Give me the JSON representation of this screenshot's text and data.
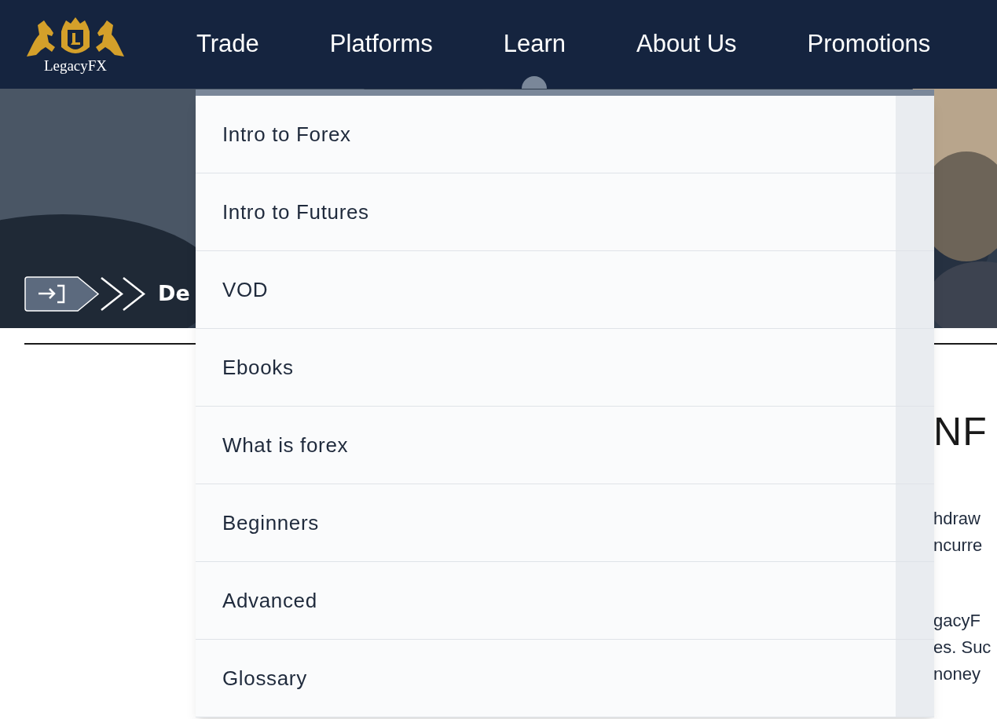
{
  "logo": {
    "text": "LegacyFX"
  },
  "nav": [
    {
      "label": "Trade",
      "selected": false
    },
    {
      "label": "Platforms",
      "selected": false
    },
    {
      "label": "Learn",
      "selected": true
    },
    {
      "label": "About Us",
      "selected": false
    },
    {
      "label": "Promotions",
      "selected": false
    }
  ],
  "breadcrumb": {
    "text": "De"
  },
  "learn_menu": [
    "Intro to Forex",
    "Intro to Futures",
    "VOD",
    "Ebooks",
    "What is forex",
    "Beginners",
    "Advanced",
    "Glossary"
  ],
  "content": {
    "heading": "NF",
    "lines": [
      "hdraw",
      "ncurre",
      "gacyF",
      "es. Suc",
      "noney"
    ]
  }
}
